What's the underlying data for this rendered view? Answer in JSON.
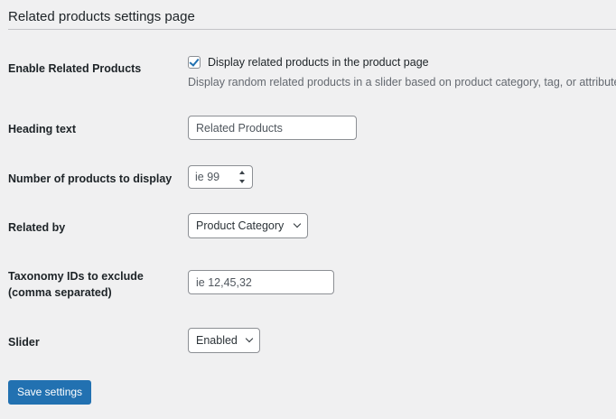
{
  "page": {
    "title": "Related products settings page"
  },
  "settings": {
    "enable": {
      "label": "Enable Related Products",
      "checkbox_label": "Display related products in the product page",
      "checked": true,
      "description": "Display random related products in a slider based on product category, tag, or attribute."
    },
    "heading": {
      "label": "Heading text",
      "value": "Related Products"
    },
    "count": {
      "label": "Number of products to display",
      "placeholder": "ie 99"
    },
    "related_by": {
      "label": "Related by",
      "selected": "Product Category"
    },
    "exclude": {
      "label": "Taxonomy IDs to exclude",
      "label_line2": "(comma separated)",
      "placeholder": "ie 12,45,32"
    },
    "slider": {
      "label": "Slider",
      "selected": "Enabled"
    }
  },
  "actions": {
    "save_label": "Save settings"
  },
  "colors": {
    "primary": "#2271b1",
    "background": "#f0f0f1",
    "text": "#1d2327",
    "muted_text": "#646970",
    "input_border": "#8c8f94"
  }
}
